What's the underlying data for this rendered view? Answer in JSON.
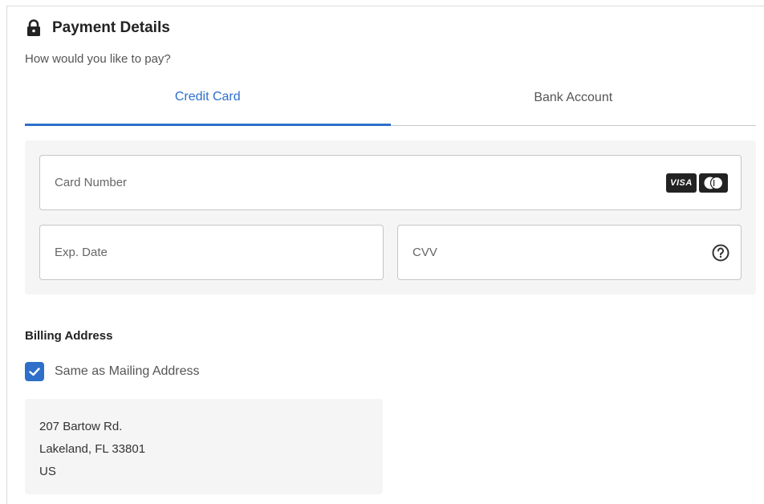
{
  "header": {
    "icon": "lock-icon",
    "title": "Payment Details",
    "subtitle": "How would you like to pay?"
  },
  "tabs": [
    {
      "label": "Credit Card",
      "active": true
    },
    {
      "label": "Bank Account",
      "active": false
    }
  ],
  "card_form": {
    "card_number_placeholder": "Card Number",
    "exp_date_placeholder": "Exp. Date",
    "cvv_placeholder": "CVV",
    "card_logos": {
      "visa": "VISA",
      "mastercard": "mastercard-logo"
    },
    "help_icon": "question-circle-icon"
  },
  "billing": {
    "title": "Billing Address",
    "same_as_mailing_label": "Same as Mailing Address",
    "same_as_mailing_checked": true,
    "address_lines": [
      "207 Bartow Rd.",
      "Lakeland, FL 33801",
      "US"
    ]
  },
  "colors": {
    "accent": "#2d6fc9",
    "panel_bg": "#f5f5f5"
  }
}
